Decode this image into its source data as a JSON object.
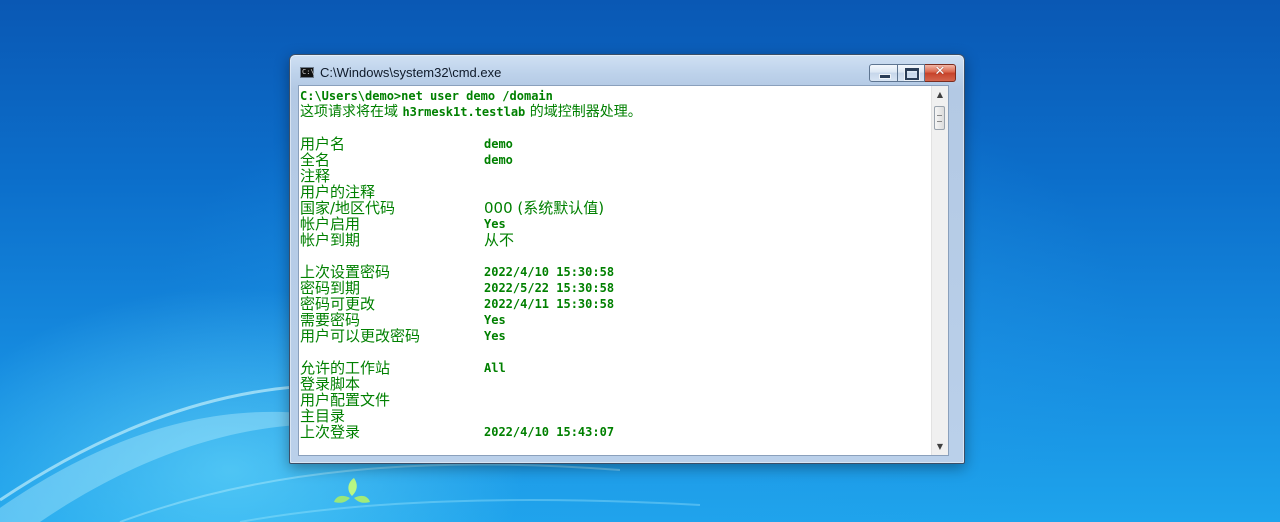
{
  "window": {
    "title": "C:\\Windows\\system32\\cmd.exe",
    "icon_text": "C:\\",
    "buttons": {
      "minimize": "minimize-icon",
      "maximize": "maximize-icon",
      "close": "✕"
    }
  },
  "console": {
    "command": "C:\\Users\\demo>net user demo /domain",
    "message_prefix": "这项请求将在域 ",
    "message_domain": "h3rmesk1t.testlab",
    "message_suffix": " 的域控制器处理。",
    "rows": [
      {
        "label": "用户名",
        "value": "demo"
      },
      {
        "label": "全名",
        "value": "demo"
      },
      {
        "label": "注释",
        "value": ""
      },
      {
        "label": "用户的注释",
        "value": ""
      },
      {
        "label": "国家/地区代码",
        "value": "000 (系统默认值)"
      },
      {
        "label": "帐户启用",
        "value": "Yes"
      },
      {
        "label": "帐户到期",
        "value": "从不"
      },
      {
        "label": "",
        "value": ""
      },
      {
        "label": "上次设置密码",
        "value": "2022/4/10 15:30:58"
      },
      {
        "label": "密码到期",
        "value": "2022/5/22 15:30:58"
      },
      {
        "label": "密码可更改",
        "value": "2022/4/11 15:30:58"
      },
      {
        "label": "需要密码",
        "value": "Yes"
      },
      {
        "label": "用户可以更改密码",
        "value": "Yes"
      },
      {
        "label": "",
        "value": ""
      },
      {
        "label": "允许的工作站",
        "value": "All"
      },
      {
        "label": "登录脚本",
        "value": ""
      },
      {
        "label": "用户配置文件",
        "value": ""
      },
      {
        "label": "主目录",
        "value": ""
      },
      {
        "label": "上次登录",
        "value": "2022/4/10 15:43:07"
      }
    ]
  },
  "colors": {
    "console_text": "#008000",
    "console_background": "#ffffff",
    "desktop": "#0c6fcb"
  }
}
